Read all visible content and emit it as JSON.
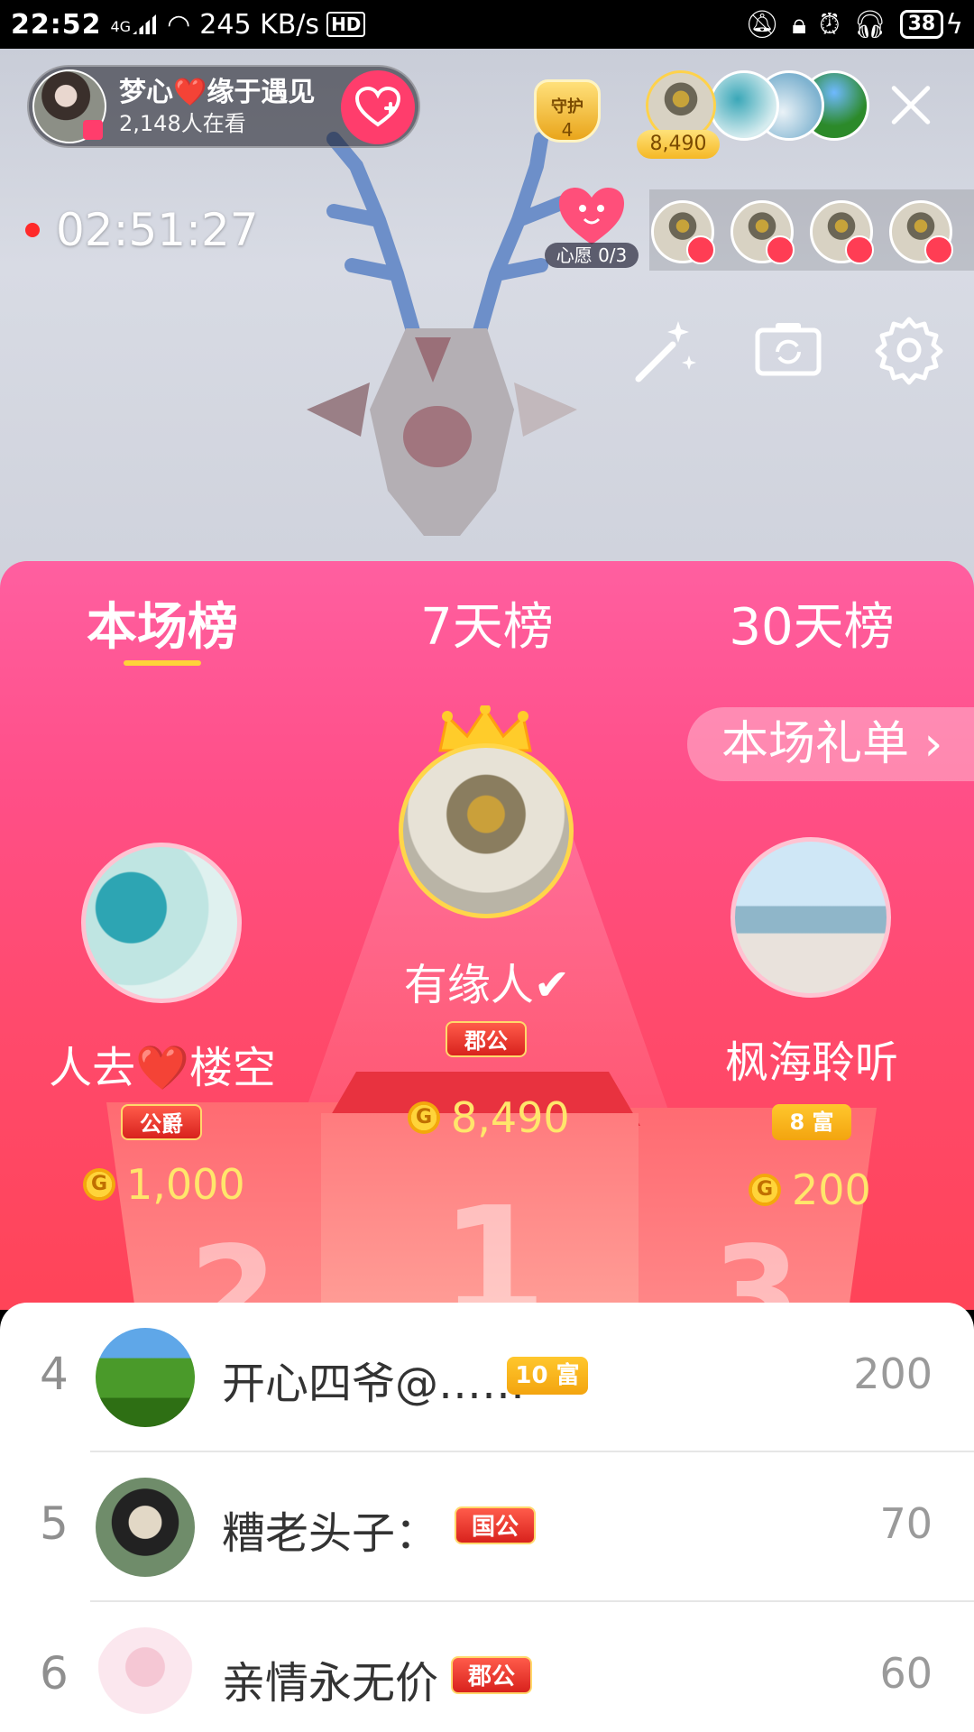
{
  "status_bar": {
    "time": "22:52",
    "network": "4G",
    "speed": "245 KB/s",
    "hd": "HD",
    "battery": "38"
  },
  "live": {
    "host_name": "梦心❤️缘于遇见",
    "viewers": "2,148人在看",
    "guard_label": "守护",
    "guard_count": "4",
    "top_contribution": "8,490",
    "timer": "02:51:27",
    "wish_label": "心愿 0/3"
  },
  "ranking": {
    "tabs": [
      "本场榜",
      "7天榜",
      "30天榜"
    ],
    "active_tab": 0,
    "gift_list_label": "本场礼单 ›",
    "first": {
      "name": "有缘人✔",
      "badge": "郡公",
      "coins": "8,490",
      "rank": "1"
    },
    "second": {
      "name": "人去❤️楼空",
      "badge": "公爵",
      "coins": "1,000",
      "rank": "2"
    },
    "third": {
      "name": "枫海聆听",
      "badge": "8 富",
      "coins": "200",
      "rank": "3"
    },
    "rows": [
      {
        "rank": "4",
        "name": "开心四爷@……",
        "badge": "10 富",
        "value": "200"
      },
      {
        "rank": "5",
        "name": "糟老头子：",
        "badge": "国公",
        "value": "70"
      },
      {
        "rank": "6",
        "name": "亲情永无价",
        "badge": "郡公",
        "value": "60"
      }
    ]
  },
  "colors": {
    "accent": "#ff3d6c",
    "panel_top": "#ff5fa0",
    "panel_bottom": "#ff4458",
    "coin_text": "#ffe66b",
    "tab_indicator": "#ffd23a"
  },
  "icons": [
    "close-icon",
    "follow-heart-icon",
    "magic-wand-icon",
    "camera-flip-icon",
    "settings-gear-icon",
    "coin-icon",
    "crown-icon",
    "mic-seat-icon"
  ]
}
